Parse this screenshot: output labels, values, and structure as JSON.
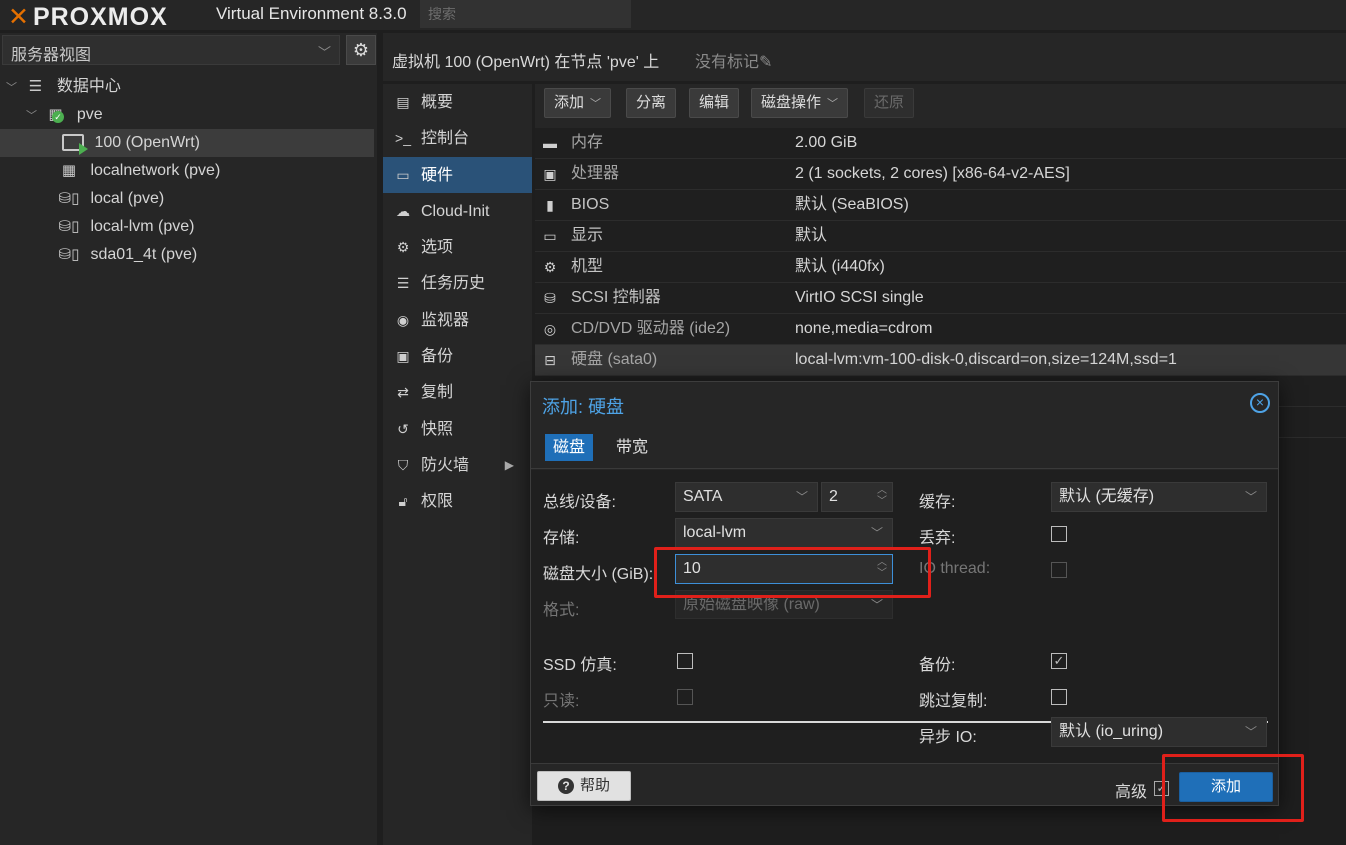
{
  "topbar": {
    "logo_text": "PROXMOX",
    "version": "Virtual Environment 8.3.0",
    "search_placeholder": "搜索"
  },
  "left": {
    "view_label": "服务器视图",
    "tree": [
      {
        "label": "数据中心",
        "icon": "datacenter-icon"
      },
      {
        "label": "pve",
        "icon": "node-icon"
      },
      {
        "label": "100 (OpenWrt)",
        "icon": "vm-running-icon"
      },
      {
        "label": "localnetwork (pve)",
        "icon": "network-grid-icon"
      },
      {
        "label": "local (pve)",
        "icon": "storage-icon"
      },
      {
        "label": "local-lvm (pve)",
        "icon": "storage-icon"
      },
      {
        "label": "sda01_4t (pve)",
        "icon": "storage-icon"
      }
    ]
  },
  "header": {
    "title": "虚拟机 100 (OpenWrt) 在节点 'pve' 上",
    "tags": "没有标记"
  },
  "nav": {
    "items": [
      {
        "label": "概要",
        "icon": "book-icon"
      },
      {
        "label": "控制台",
        "icon": "terminal-icon"
      },
      {
        "label": "硬件",
        "icon": "monitor-icon"
      },
      {
        "label": "Cloud-Init",
        "icon": "cloud-icon"
      },
      {
        "label": "选项",
        "icon": "gear-icon"
      },
      {
        "label": "任务历史",
        "icon": "list-icon"
      },
      {
        "label": "监视器",
        "icon": "eye-icon"
      },
      {
        "label": "备份",
        "icon": "floppy-icon"
      },
      {
        "label": "复制",
        "icon": "retweet-icon"
      },
      {
        "label": "快照",
        "icon": "history-icon"
      },
      {
        "label": "防火墙",
        "icon": "shield-icon"
      },
      {
        "label": "权限",
        "icon": "unlock-icon"
      }
    ]
  },
  "toolbar": {
    "add": "添加",
    "detach": "分离",
    "edit": "编辑",
    "disk_action": "磁盘操作",
    "revert": "还原"
  },
  "hardware": [
    {
      "key": "内存",
      "value": "2.00 GiB",
      "icon": "memory-icon"
    },
    {
      "key": "处理器",
      "value": "2 (1 sockets, 2 cores) [x86-64-v2-AES]",
      "icon": "cpu-icon"
    },
    {
      "key": "BIOS",
      "value": "默认 (SeaBIOS)",
      "icon": "microchip-icon"
    },
    {
      "key": "显示",
      "value": "默认",
      "icon": "desktop-icon"
    },
    {
      "key": "机型",
      "value": "默认 (i440fx)",
      "icon": "cogs-icon"
    },
    {
      "key": "SCSI 控制器",
      "value": "VirtIO SCSI single",
      "icon": "database-icon"
    },
    {
      "key": "CD/DVD 驱动器 (ide2)",
      "value": "none,media=cdrom",
      "icon": "cdrom-icon"
    },
    {
      "key": "硬盘 (sata0)",
      "value": "local-lvm:vm-100-disk-0,discard=on,size=124M,ssd=1",
      "icon": "hdd-icon"
    }
  ],
  "dialog": {
    "title": "添加: 硬盘",
    "tabs": [
      "磁盘",
      "带宽"
    ],
    "bus_label": "总线/设备:",
    "bus_value": "SATA",
    "device_value": "2",
    "storage_label": "存储:",
    "storage_value": "local-lvm",
    "size_label": "磁盘大小 (GiB):",
    "size_value": "10",
    "format_label": "格式:",
    "format_value": "原始磁盘映像 (raw)",
    "cache_label": "缓存:",
    "cache_value": "默认 (无缓存)",
    "discard_label": "丢弃:",
    "iothread_label": "IO thread:",
    "ssd_label": "SSD 仿真:",
    "readonly_label": "只读:",
    "backup_label": "备份:",
    "skip_repl_label": "跳过复制:",
    "async_label": "异步 IO:",
    "async_value": "默认 (io_uring)",
    "help": "帮助",
    "advanced": "高级",
    "add": "添加",
    "checks": {
      "discard": false,
      "iothread": false,
      "ssd": false,
      "readonly": false,
      "backup": true,
      "skip_repl": false,
      "advanced": true
    }
  },
  "colors": {
    "accent": "#1f6fb8",
    "annotation": "#e0201a",
    "running": "#4caf50"
  }
}
